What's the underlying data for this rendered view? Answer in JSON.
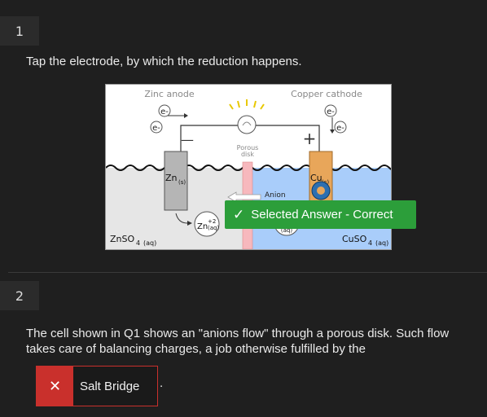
{
  "q1": {
    "number": "1",
    "prompt": "Tap the electrode, by which the reduction happens.",
    "diagram": {
      "zinc_label": "Zinc anode",
      "copper_label": "Copper cathode",
      "electron": "e-",
      "minus_sign": "—",
      "plus_sign": "+",
      "porous_label_1": "Porous",
      "porous_label_2": "disk",
      "zn_electrode": "Zn",
      "zn_electrode_sub": "(s)",
      "cu_electrode": "Cu",
      "cu_electrode_sub": "(s)",
      "anion_label": "Anion",
      "zn_ion": "Zn",
      "zn_ion_sup": "+2",
      "zn_ion_sub": "(aq)",
      "cu_ion_sub": "(aq)",
      "znso4": "ZnSO",
      "znso4_sub": "4",
      "znso4_phase": "(aq)",
      "cuso4": "CuSO",
      "cuso4_sub": "4",
      "cuso4_phase": "(aq)"
    },
    "feedback": "Selected Answer - Correct",
    "feedback_icon": "check-icon"
  },
  "q2": {
    "number": "2",
    "prompt_line1": "The cell shown in Q1 shows an \"anions flow\" through a porous disk. Such flow",
    "prompt_line2": "takes care of balancing charges, a job otherwise fulfilled by the",
    "answer": "Salt Bridge",
    "answer_icon": "close-icon",
    "trailing": "."
  },
  "colors": {
    "background": "#1f1f1f",
    "correct": "#2c9e3a",
    "incorrect": "#c9302c",
    "zinc_solution": "#e6e6e6",
    "copper_solution": "#a9cdfa",
    "copper_electrode": "#e8a65a"
  }
}
